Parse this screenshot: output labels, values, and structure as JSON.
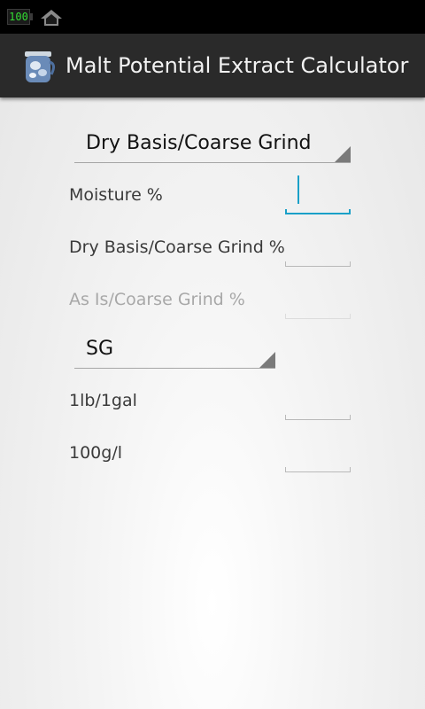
{
  "status_bar": {
    "battery_level": "100",
    "battery_color": "#33dd33",
    "home_icon": "home-icon"
  },
  "action_bar": {
    "title": "Malt Potential Extract Calculator",
    "app_icon": "malt-jar-icon"
  },
  "form": {
    "basis_spinner": {
      "selected": "Dry Basis/Coarse Grind"
    },
    "moisture": {
      "label": "Moisture %",
      "value": ""
    },
    "dry_basis": {
      "label": "Dry Basis/Coarse Grind %",
      "value": ""
    },
    "as_is": {
      "label": "As Is/Coarse Grind %",
      "value": "",
      "enabled": false
    },
    "unit_spinner": {
      "selected": "SG"
    },
    "lb_gal": {
      "label": "1lb/1gal",
      "value": ""
    },
    "g_l": {
      "label": "100g/l",
      "value": ""
    }
  },
  "colors": {
    "accent": "#1aa0c8",
    "action_bar": "#2a2a2a"
  }
}
